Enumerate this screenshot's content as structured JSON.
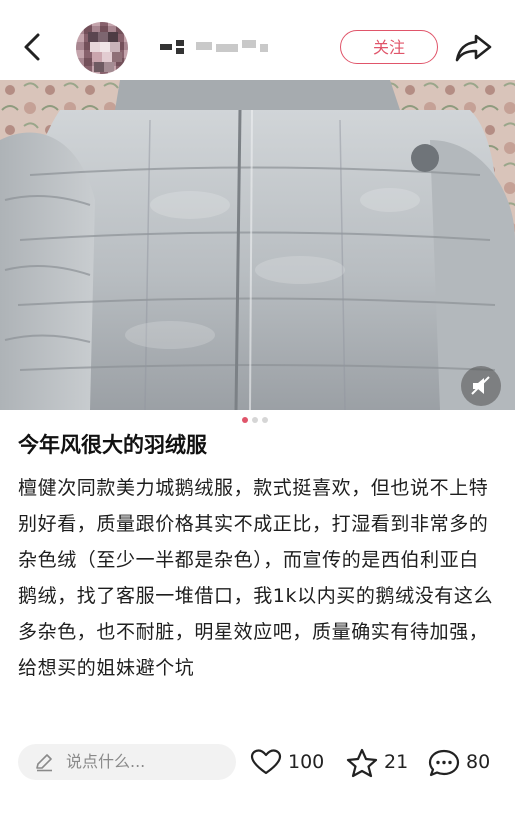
{
  "header": {
    "follow_label": "关注",
    "icons": {
      "back": "back-arrow-icon",
      "share": "share-icon"
    }
  },
  "photo": {
    "alt": "灰色羽绒服照片",
    "page_count": 3,
    "active_index": 0,
    "icons": {
      "mute": "mute-icon"
    }
  },
  "post": {
    "title": "今年风很大的羽绒服",
    "body": "檀健次同款美力城鹅绒服，款式挺喜欢，但也说不上特别好看，质量跟价格其实不成正比，打湿看到非常多的杂色绒（至少一半都是杂色），而宣传的是西伯利亚白鹅绒，找了客服一堆借口，我1k以内买的鹅绒没有这么多杂色，也不耐脏，明星效应吧，质量确实有待加强，给想买的姐妹避个坑"
  },
  "bottom_bar": {
    "comment_placeholder": "说点什么...",
    "likes": "100",
    "favorites": "21",
    "comments": "80",
    "icons": {
      "edit": "pen-icon",
      "like": "heart-icon",
      "favorite": "star-icon",
      "comment": "comment-bubble-icon"
    }
  },
  "colors": {
    "accent": "#e0556a",
    "jacket": "#b7bcc0",
    "sheet": "#d8c2b8"
  }
}
